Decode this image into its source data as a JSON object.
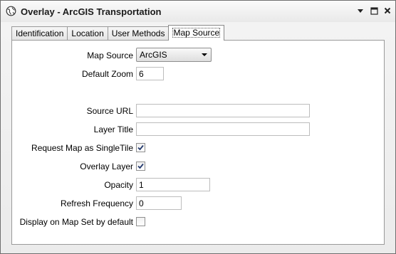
{
  "window": {
    "title": "Overlay - ArcGIS Transportation",
    "app_icon": "globe-icon",
    "controls": [
      "dropdown-arrow-icon",
      "maximize-icon",
      "close-icon"
    ]
  },
  "tabs": [
    {
      "label": "Identification",
      "active": false
    },
    {
      "label": "Location",
      "active": false
    },
    {
      "label": "User Methods",
      "active": false
    },
    {
      "label": "Map Source",
      "active": true
    }
  ],
  "form": {
    "map_source": {
      "label": "Map Source",
      "value": "ArcGIS"
    },
    "default_zoom": {
      "label": "Default Zoom",
      "value": "6"
    },
    "source_url": {
      "label": "Source URL",
      "value": ""
    },
    "layer_title": {
      "label": "Layer Title",
      "value": ""
    },
    "request_single_tile": {
      "label": "Request Map as SingleTile",
      "checked": true
    },
    "overlay_layer": {
      "label": "Overlay Layer",
      "checked": true
    },
    "opacity": {
      "label": "Opacity",
      "value": "1"
    },
    "refresh_frequency": {
      "label": "Refresh Frequency",
      "value": "0"
    },
    "display_default": {
      "label": "Display on Map Set by default",
      "checked": false
    }
  }
}
